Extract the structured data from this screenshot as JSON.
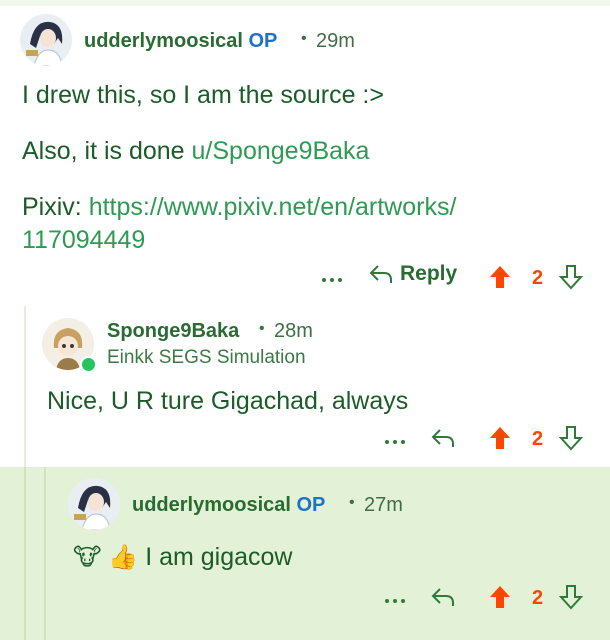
{
  "colors": {
    "accent_green": "#2a6b33",
    "op_blue": "#1e73c8",
    "upvote_orange": "#ff4500",
    "highlight_bg": "#e3f1d6"
  },
  "comment1": {
    "username": "udderlymoosical",
    "op_badge": "OP",
    "separator": "•",
    "time": "29m",
    "line1": "I drew this, so I am the source :>",
    "line2_prefix": "Also, it is done ",
    "line2_link": "u/Sponge9Baka",
    "line3_prefix": "Pixiv: ",
    "line3_link_a": "https://www.pixiv.net/en/artworks/",
    "line3_link_b": "117094449",
    "more_icon": "more-dots-icon",
    "reply_label": "Reply",
    "score": "2"
  },
  "comment2": {
    "username": "Sponge9Baka",
    "separator": "•",
    "time": "28m",
    "flair": "Einkk SEGS Simulation",
    "body": "Nice, U R ture Gigachad, always",
    "score": "2"
  },
  "comment3": {
    "username": "udderlymoosical",
    "op_badge": "OP",
    "separator": "•",
    "time": "27m",
    "emoji_cow": "🐮",
    "emoji_thumb": "👍",
    "body": " I am gigacow",
    "score": "2"
  }
}
